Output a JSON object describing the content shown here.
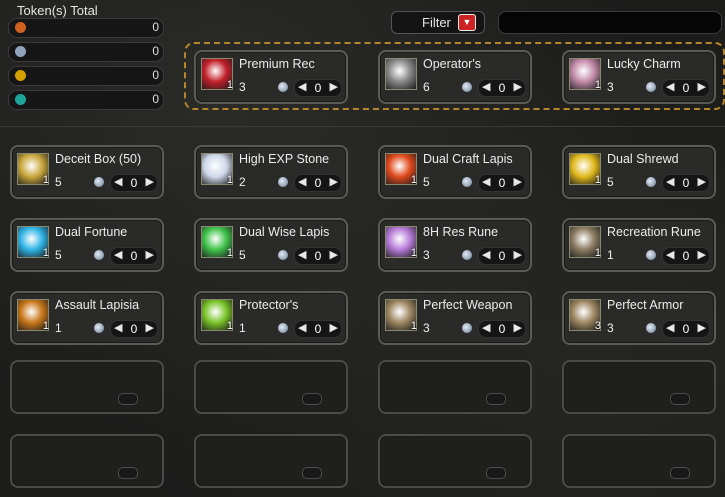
{
  "tokens": {
    "title": "Token(s) Total",
    "rows": [
      {
        "icon": "orange-token-icon",
        "color": "#d06020",
        "value": "0"
      },
      {
        "icon": "silver-token-icon",
        "color": "#8fa4bb",
        "value": "0"
      },
      {
        "icon": "gold-token-icon",
        "color": "#d4a000",
        "value": "0"
      },
      {
        "icon": "teal-token-icon",
        "color": "#1ea59b",
        "value": "0"
      }
    ]
  },
  "filter": {
    "label": "Filter",
    "dropdown_glyph": "▼"
  },
  "search": {
    "value": ""
  },
  "featured_items": [
    {
      "name": "Premium Rec",
      "icon": "red-robe-icon",
      "icon_color": "#c2202a",
      "icon_qty": "1",
      "stock": "3",
      "qty": "0"
    },
    {
      "name": "Operator's",
      "icon": "hammer-icon",
      "icon_color": "#888888",
      "icon_qty": "",
      "stock": "6",
      "qty": "0"
    },
    {
      "name": "Lucky Charm",
      "icon": "charm-icon",
      "icon_color": "#c28aa8",
      "icon_qty": "1",
      "stock": "3",
      "qty": "0"
    }
  ],
  "items": [
    {
      "name": "Deceit Box (50)",
      "icon": "treasure-chest-icon",
      "icon_color": "#c9a63c",
      "icon_qty": "1",
      "stock": "5",
      "qty": "0"
    },
    {
      "name": "High EXP Stone",
      "icon": "exp-stone-icon",
      "icon_color": "#cfd8ea",
      "icon_qty": "1",
      "stock": "2",
      "qty": "0"
    },
    {
      "name": "Dual Craft Lapis",
      "icon": "red-gem-icon",
      "icon_color": "#e04a1c",
      "icon_qty": "1",
      "stock": "5",
      "qty": "0"
    },
    {
      "name": "Dual Shrewd",
      "icon": "yellow-gem-icon",
      "icon_color": "#e0b81c",
      "icon_qty": "1",
      "stock": "5",
      "qty": "0"
    },
    {
      "name": "Dual Fortune",
      "icon": "blue-gem-icon",
      "icon_color": "#2fb4e6",
      "icon_qty": "1",
      "stock": "5",
      "qty": "0"
    },
    {
      "name": "Dual Wise Lapis",
      "icon": "green-gem-icon",
      "icon_color": "#3fc24a",
      "icon_qty": "1",
      "stock": "5",
      "qty": "0"
    },
    {
      "name": "8H Res Rune",
      "icon": "purple-rune-icon",
      "icon_color": "#b57ad6",
      "icon_qty": "1",
      "stock": "3",
      "qty": "0"
    },
    {
      "name": "Recreation Rune",
      "icon": "coin-rune-icon",
      "icon_color": "#8a7a60",
      "icon_qty": "1",
      "stock": "1",
      "qty": "0"
    },
    {
      "name": "Assault Lapisia",
      "icon": "orange-egg-icon",
      "icon_color": "#c8761a",
      "icon_qty": "1",
      "stock": "1",
      "qty": "0"
    },
    {
      "name": "Protector's",
      "icon": "green-egg-icon",
      "icon_color": "#7ac42a",
      "icon_qty": "1",
      "stock": "1",
      "qty": "0"
    },
    {
      "name": "Perfect Weapon",
      "icon": "crossed-swords-icon",
      "icon_color": "#9c8660",
      "icon_qty": "1",
      "stock": "3",
      "qty": "0"
    },
    {
      "name": "Perfect Armor",
      "icon": "armor-icon",
      "icon_color": "#9c8660",
      "icon_qty": "3",
      "stock": "3",
      "qty": "0"
    }
  ],
  "stepper": {
    "left": "◀",
    "right": "▶"
  }
}
